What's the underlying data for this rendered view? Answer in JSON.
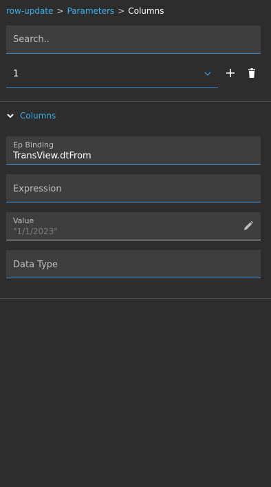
{
  "breadcrumb": {
    "items": [
      "row-update",
      "Parameters"
    ],
    "separator": ">",
    "current": "Columns"
  },
  "search": {
    "placeholder": "Search.."
  },
  "selector": {
    "value": "1"
  },
  "section": {
    "title": "Columns",
    "expanded": true
  },
  "fields": {
    "ep_binding": {
      "label": "Ep Binding",
      "value": "TransView.dtFrom"
    },
    "expression": {
      "placeholder": "Expression"
    },
    "value": {
      "label": "Value",
      "value": "\"1/1/2023\""
    },
    "data_type": {
      "placeholder": "Data Type"
    }
  },
  "icons": {
    "dropdown": "chevron-down-icon",
    "add": "plus-icon",
    "delete": "trash-icon",
    "section_toggle": "chevron-down-icon",
    "edit": "pencil-icon"
  },
  "colors": {
    "background": "#2d2d2d",
    "field_bg": "#3e3e3e",
    "accent": "#3fb0e8",
    "underline": "#3a8fd6"
  }
}
